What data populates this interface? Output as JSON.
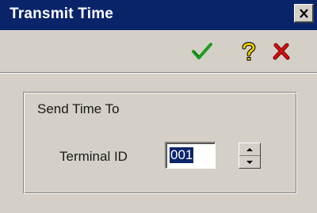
{
  "window": {
    "title": "Transmit Time",
    "close_icon": "close-x-icon"
  },
  "toolbar": {
    "ok_icon": "green-checkmark-icon",
    "help_icon": "yellow-question-mark-icon",
    "cancel_icon": "red-x-icon",
    "colors": {
      "ok": "#1e9e1e",
      "help": "#e8c800",
      "cancel": "#d01010"
    }
  },
  "group": {
    "title": "Send Time To",
    "field_label": "Terminal ID",
    "field_value": "001"
  },
  "spinner": {
    "up_icon": "spin-up-icon",
    "down_icon": "spin-down-icon"
  }
}
